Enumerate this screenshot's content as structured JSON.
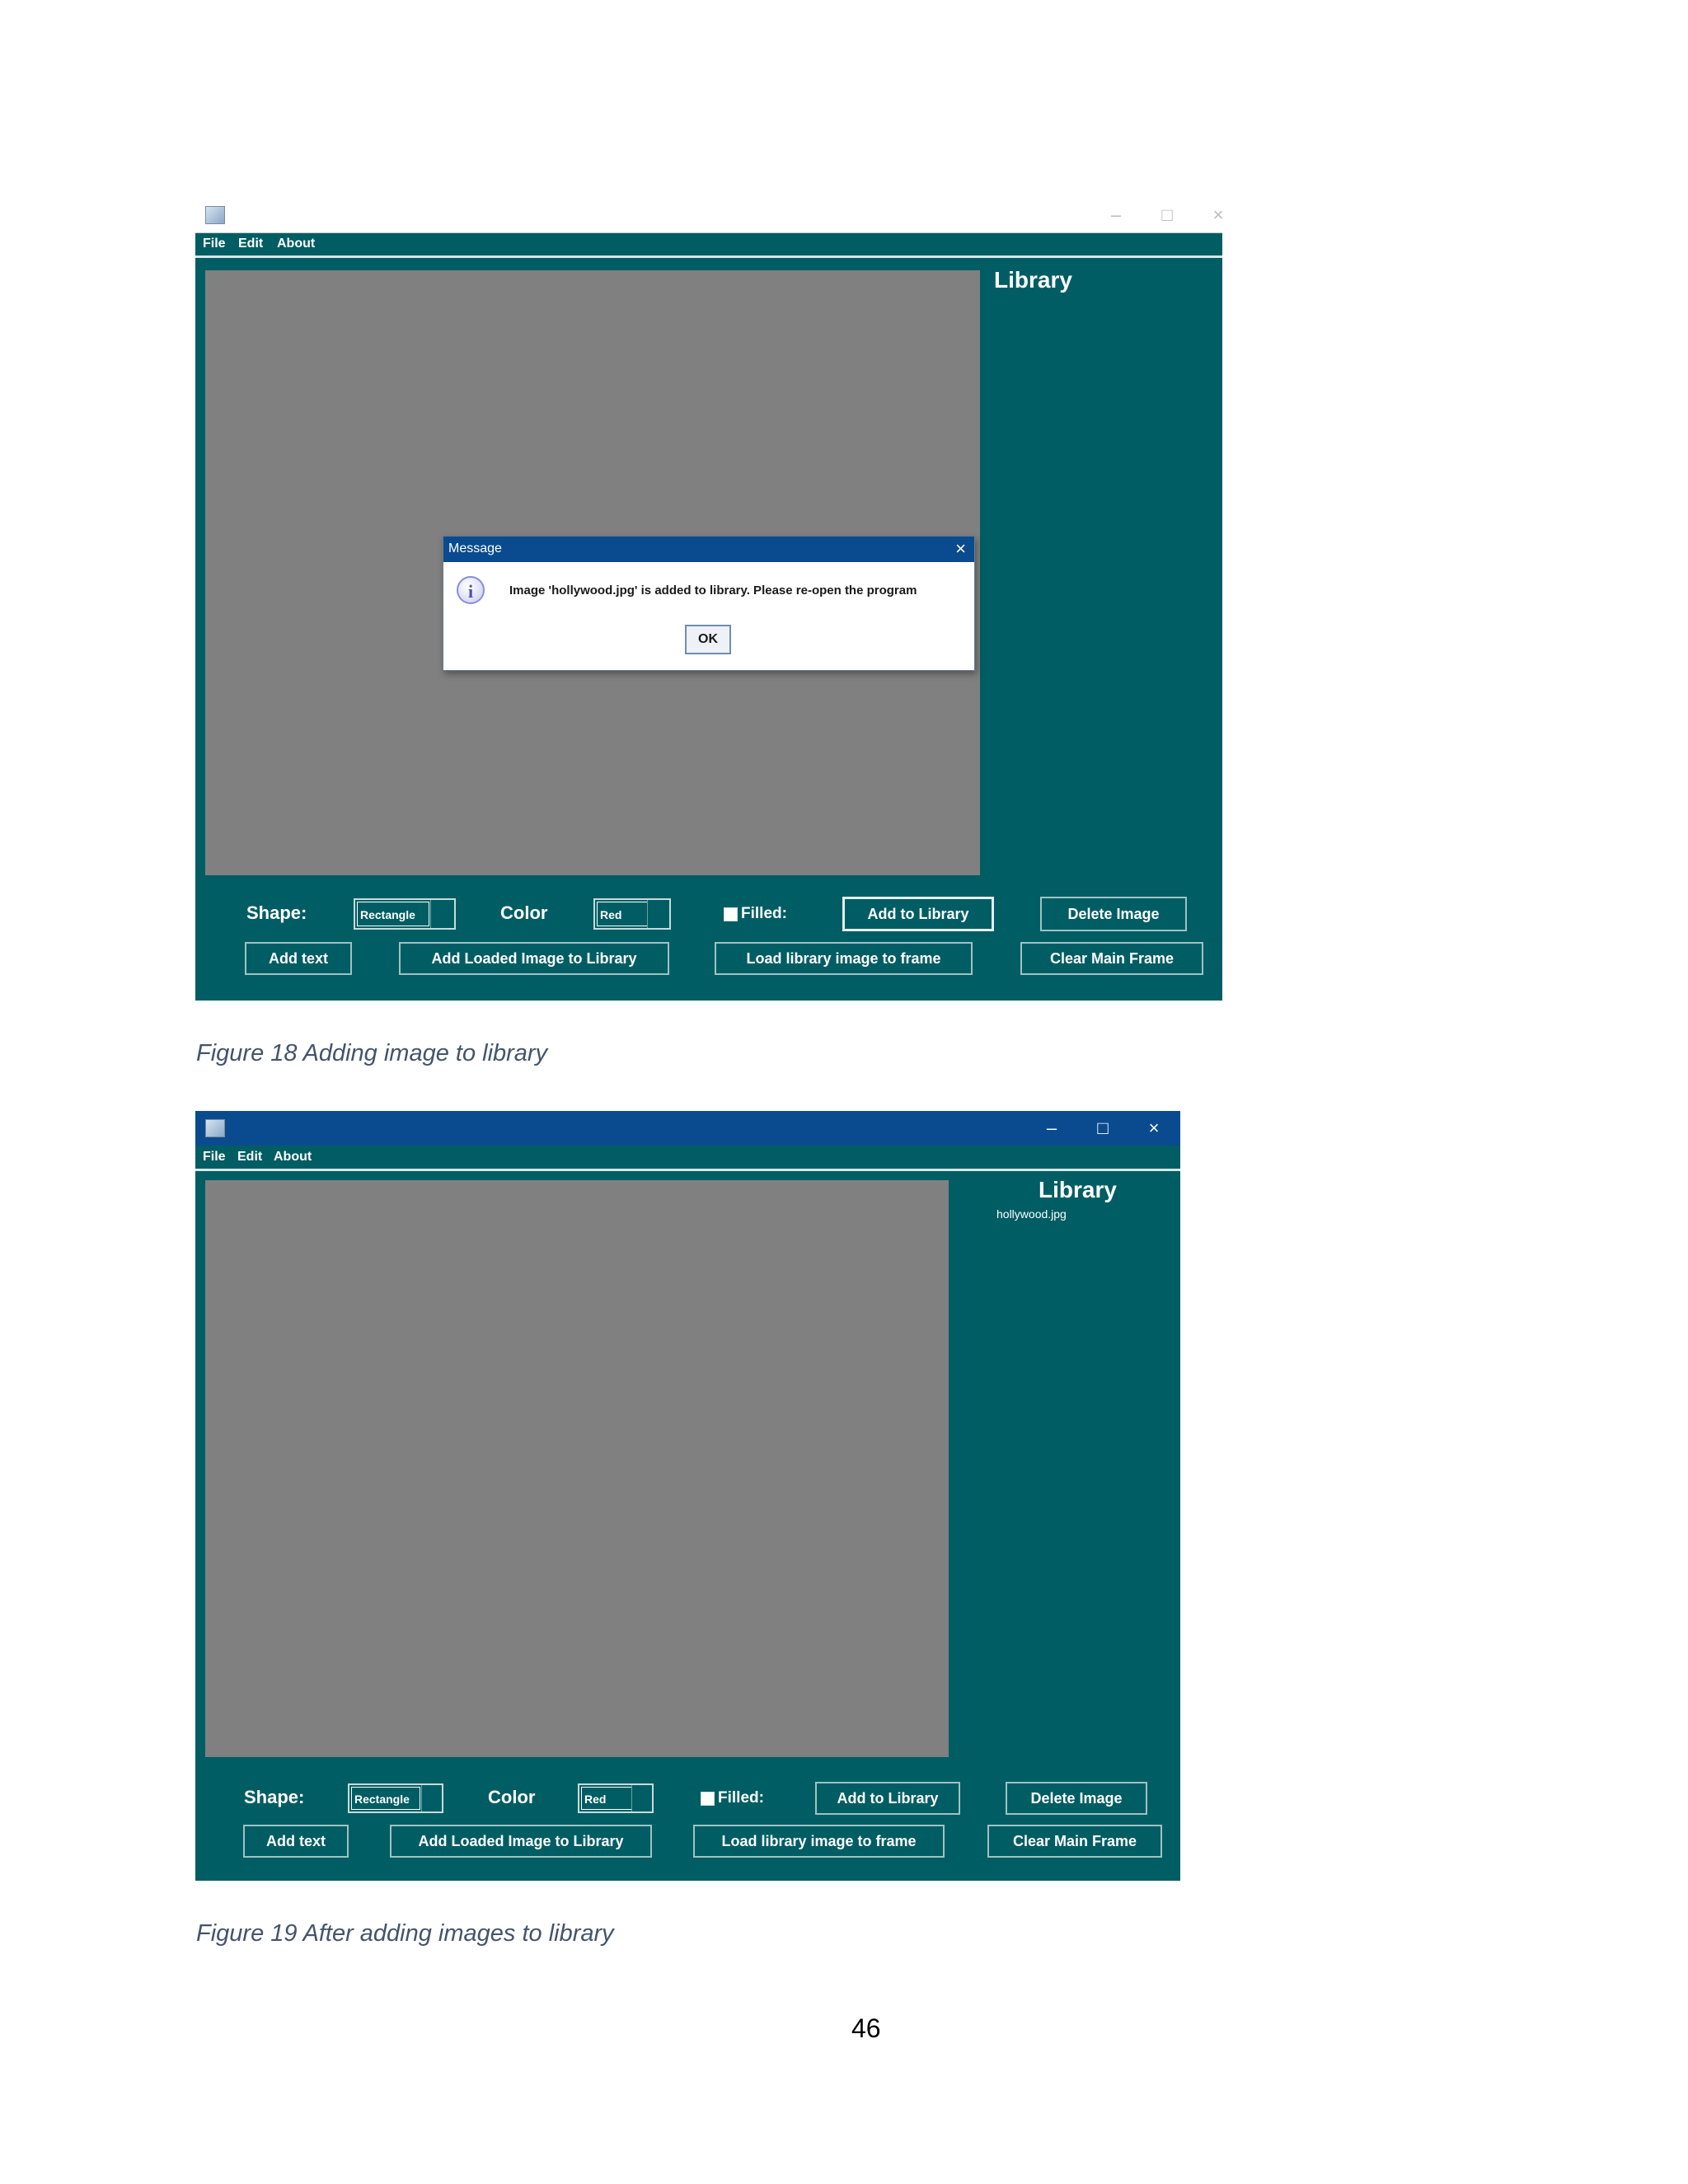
{
  "menu": [
    "File",
    "Edit",
    "About"
  ],
  "window_controls": {
    "minimize": "–",
    "maximize": "□",
    "close": "×"
  },
  "library_title": "Library",
  "controls": {
    "shape_label": "Shape:",
    "shape_value": "Rectangle",
    "color_label": "Color",
    "color_value": "Red",
    "filled_label": "Filled:",
    "add_to_library": "Add to Library",
    "delete_image": "Delete Image",
    "add_text": "Add text",
    "add_loaded": "Add Loaded Image to Library",
    "load_library": "Load library image to frame",
    "clear_main": "Clear Main Frame"
  },
  "dialog": {
    "title": "Message",
    "message": "Image 'hollywood.jpg' is added to library. Please re-open the program",
    "ok": "OK",
    "close": "×",
    "icon": "i"
  },
  "figure2_library_items": [
    "hollywood.jpg"
  ],
  "captions": {
    "fig18": "Figure 18 Adding image to library",
    "fig19": "Figure 19 After adding images to library"
  },
  "page_number": "46"
}
